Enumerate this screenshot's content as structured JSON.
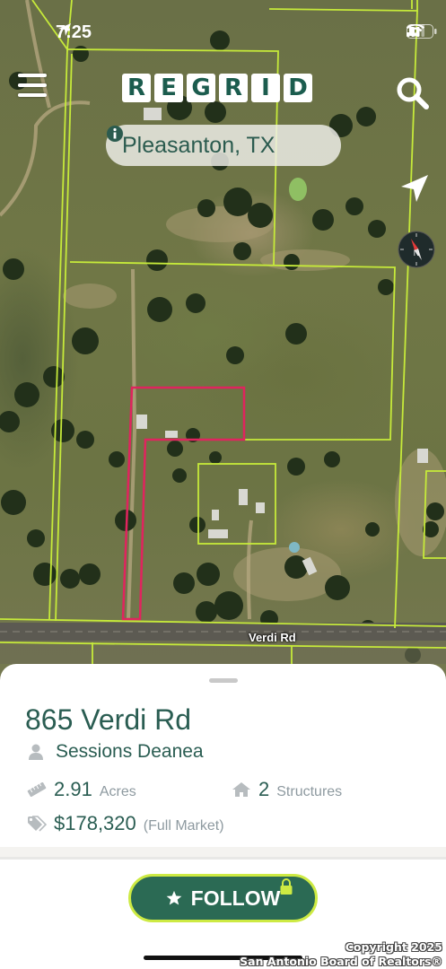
{
  "status_bar": {
    "time": "7:25"
  },
  "header": {
    "logo_letters": [
      "R",
      "E",
      "G",
      "R",
      "I",
      "D"
    ],
    "location": "Pleasanton, TX"
  },
  "map": {
    "road_label": "Verdi Rd"
  },
  "parcel": {
    "address": "865 Verdi Rd",
    "owner": "Sessions Deanea",
    "acres_value": "2.91",
    "acres_unit": "Acres",
    "structures_value": "2",
    "structures_unit": "Structures",
    "price_value": "$178,320",
    "price_note": "(Full Market)"
  },
  "actions": {
    "follow_label": "FOLLOW"
  },
  "footer": {
    "copyright_line1": "Copyright 2025",
    "copyright_line2": "San Antonio Board of Realtors®"
  },
  "colors": {
    "brand_green": "#2b6a54",
    "text_green": "#2a5d52",
    "follow_border": "#cdea43",
    "parcel_line": "#c6ea3a",
    "selected_parcel": "#e0245e"
  },
  "icons": [
    "menu-icon",
    "search-icon",
    "info-icon",
    "navigation-arrow-icon",
    "compass-icon",
    "person-icon",
    "ruler-icon",
    "house-icon",
    "price-tag-icon",
    "star-icon",
    "lock-icon"
  ]
}
